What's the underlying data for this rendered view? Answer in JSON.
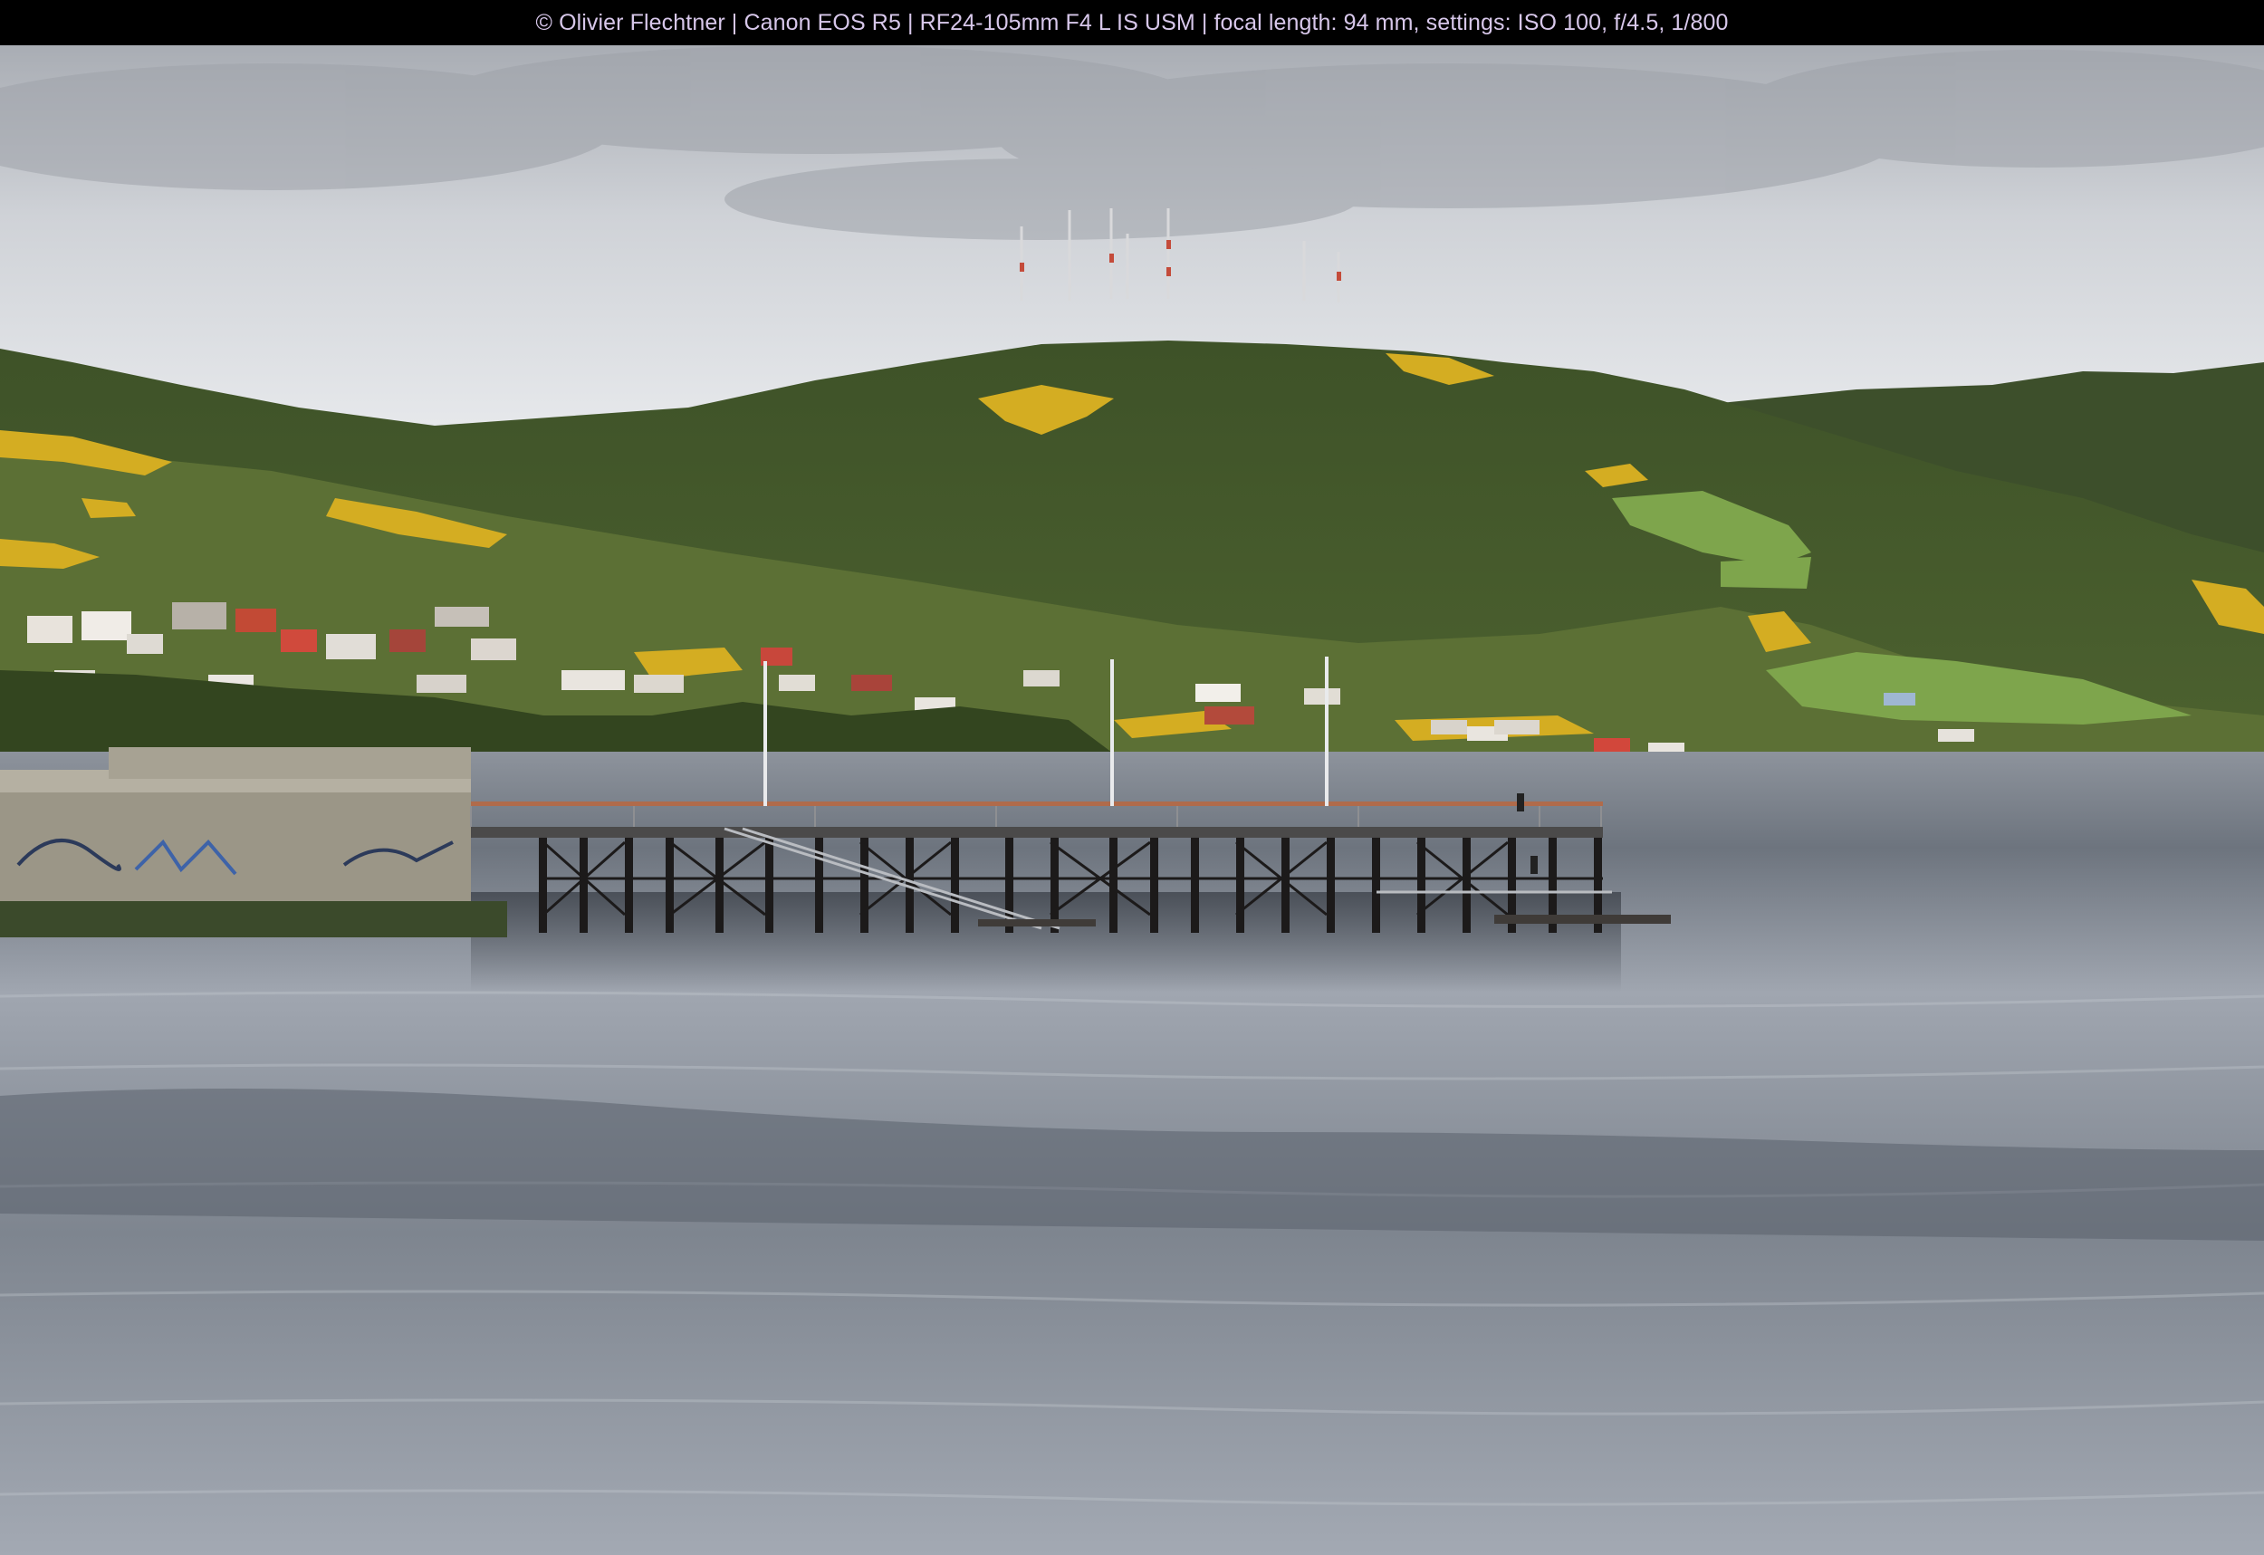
{
  "caption": {
    "text": "© Olivier Flechtner | Canon EOS R5 | RF24-105mm F4 L IS USM | focal length: 94 mm, settings: ISO 100, f/4.5, 1/800"
  },
  "photo": {
    "subject": "pier-over-water-with-forested-hill-and-town",
    "colors": {
      "sky_light": "#e4e6ea",
      "sky_cloud": "#b9bcc3",
      "hill_dark": "#3c4f26",
      "hill_mid": "#5f7232",
      "gorse_yellow": "#d9b320",
      "water_light": "#a7adb7",
      "water_dark": "#616872",
      "pier_rail": "#b46b4a",
      "pier_pile": "#1d1a1a",
      "wall": "#9a9586"
    }
  }
}
